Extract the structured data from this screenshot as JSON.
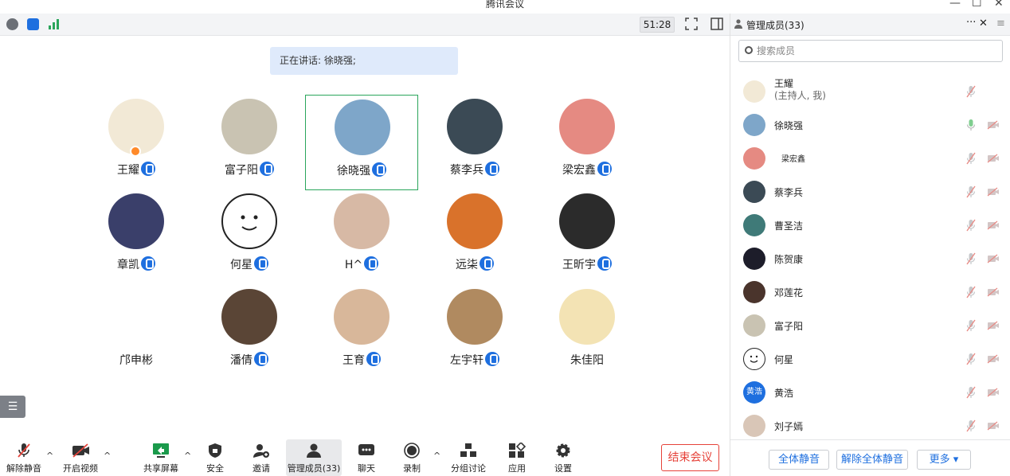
{
  "window": {
    "title": "腾讯会议",
    "minimize": "—",
    "maximize": "☐",
    "close": "✕"
  },
  "topbar": {
    "timer": "51:28"
  },
  "speaking": {
    "label": "正在讲话: 徐晓强;"
  },
  "grid": [
    {
      "name": "王耀",
      "mic": true,
      "host": true,
      "avatar_color": "#f2e9d6"
    },
    {
      "name": "富子阳",
      "mic": true,
      "avatar_color": "#c9c3b2"
    },
    {
      "name": "徐晓强",
      "mic": true,
      "active": true,
      "avatar_color": "#7ea6c9"
    },
    {
      "name": "蔡李兵",
      "mic": true,
      "avatar_color": "#3b4a55"
    },
    {
      "name": "梁宏鑫",
      "mic": true,
      "avatar_color": "#e58a82"
    },
    {
      "name": "章凯",
      "mic": true,
      "avatar_color": "#3a3f6a"
    },
    {
      "name": "何星",
      "mic": true,
      "avatar_color": "#ffffff"
    },
    {
      "name": "H^",
      "mic": true,
      "avatar_color": "#d7b9a5"
    },
    {
      "name": "远柒",
      "mic": true,
      "avatar_color": "#d9722b"
    },
    {
      "name": "王昕宇",
      "mic": true,
      "avatar_color": "#2b2b2b"
    },
    {
      "name": "邝申彬",
      "mic": false,
      "avatar_color": "#ffffff"
    },
    {
      "name": "潘倩",
      "mic": true,
      "avatar_color": "#5a4536"
    },
    {
      "name": "王育",
      "mic": true,
      "avatar_color": "#d8b79a"
    },
    {
      "name": "左宇轩",
      "mic": true,
      "avatar_color": "#b08a60"
    },
    {
      "name": "朱佳阳",
      "mic": false,
      "avatar_color": "#f3e3b4"
    }
  ],
  "toolbar": {
    "unmute": "解除静音",
    "video": "开启视频",
    "share": "共享屏幕",
    "security": "安全",
    "invite": "邀请",
    "members": "管理成员(33)",
    "chat": "聊天",
    "record": "录制",
    "breakout": "分组讨论",
    "apps": "应用",
    "settings": "设置",
    "end": "结束会议"
  },
  "panel": {
    "title": "管理成员(33)",
    "more": "···",
    "close": "✕",
    "menu": "≡",
    "search_placeholder": "搜索成员",
    "members": [
      {
        "name": "王耀",
        "sub": "(主持人, 我)",
        "avatar_color": "#f2e9d6"
      },
      {
        "name": "徐晓强",
        "avatar_color": "#7ea6c9",
        "speaking": true
      },
      {
        "name": "梁宏鑫",
        "avatar_color": "#e58a82"
      },
      {
        "name": "蔡李兵",
        "avatar_color": "#3b4a55"
      },
      {
        "name": "曹圣洁",
        "avatar_color": "#3f7a78"
      },
      {
        "name": "陈贺康",
        "avatar_color": "#1d1d2a"
      },
      {
        "name": "邓莲花",
        "avatar_color": "#4a342c"
      },
      {
        "name": "富子阳",
        "avatar_color": "#c9c3b2"
      },
      {
        "name": "何星",
        "avatar_color": "#ffffff"
      },
      {
        "name": "黄浩",
        "avatar_text": "黄浩",
        "avatar_color": "#1e6fdf"
      },
      {
        "name": "刘子嫣",
        "avatar_color": "#d9c6b7"
      }
    ],
    "mute_all": "全体静音",
    "unmute_all": "解除全体静音",
    "more_btn": "更多 ▾"
  },
  "colors": {
    "accent": "#1e6fdf",
    "end": "#e6433a",
    "active_border": "#2aa55b"
  }
}
